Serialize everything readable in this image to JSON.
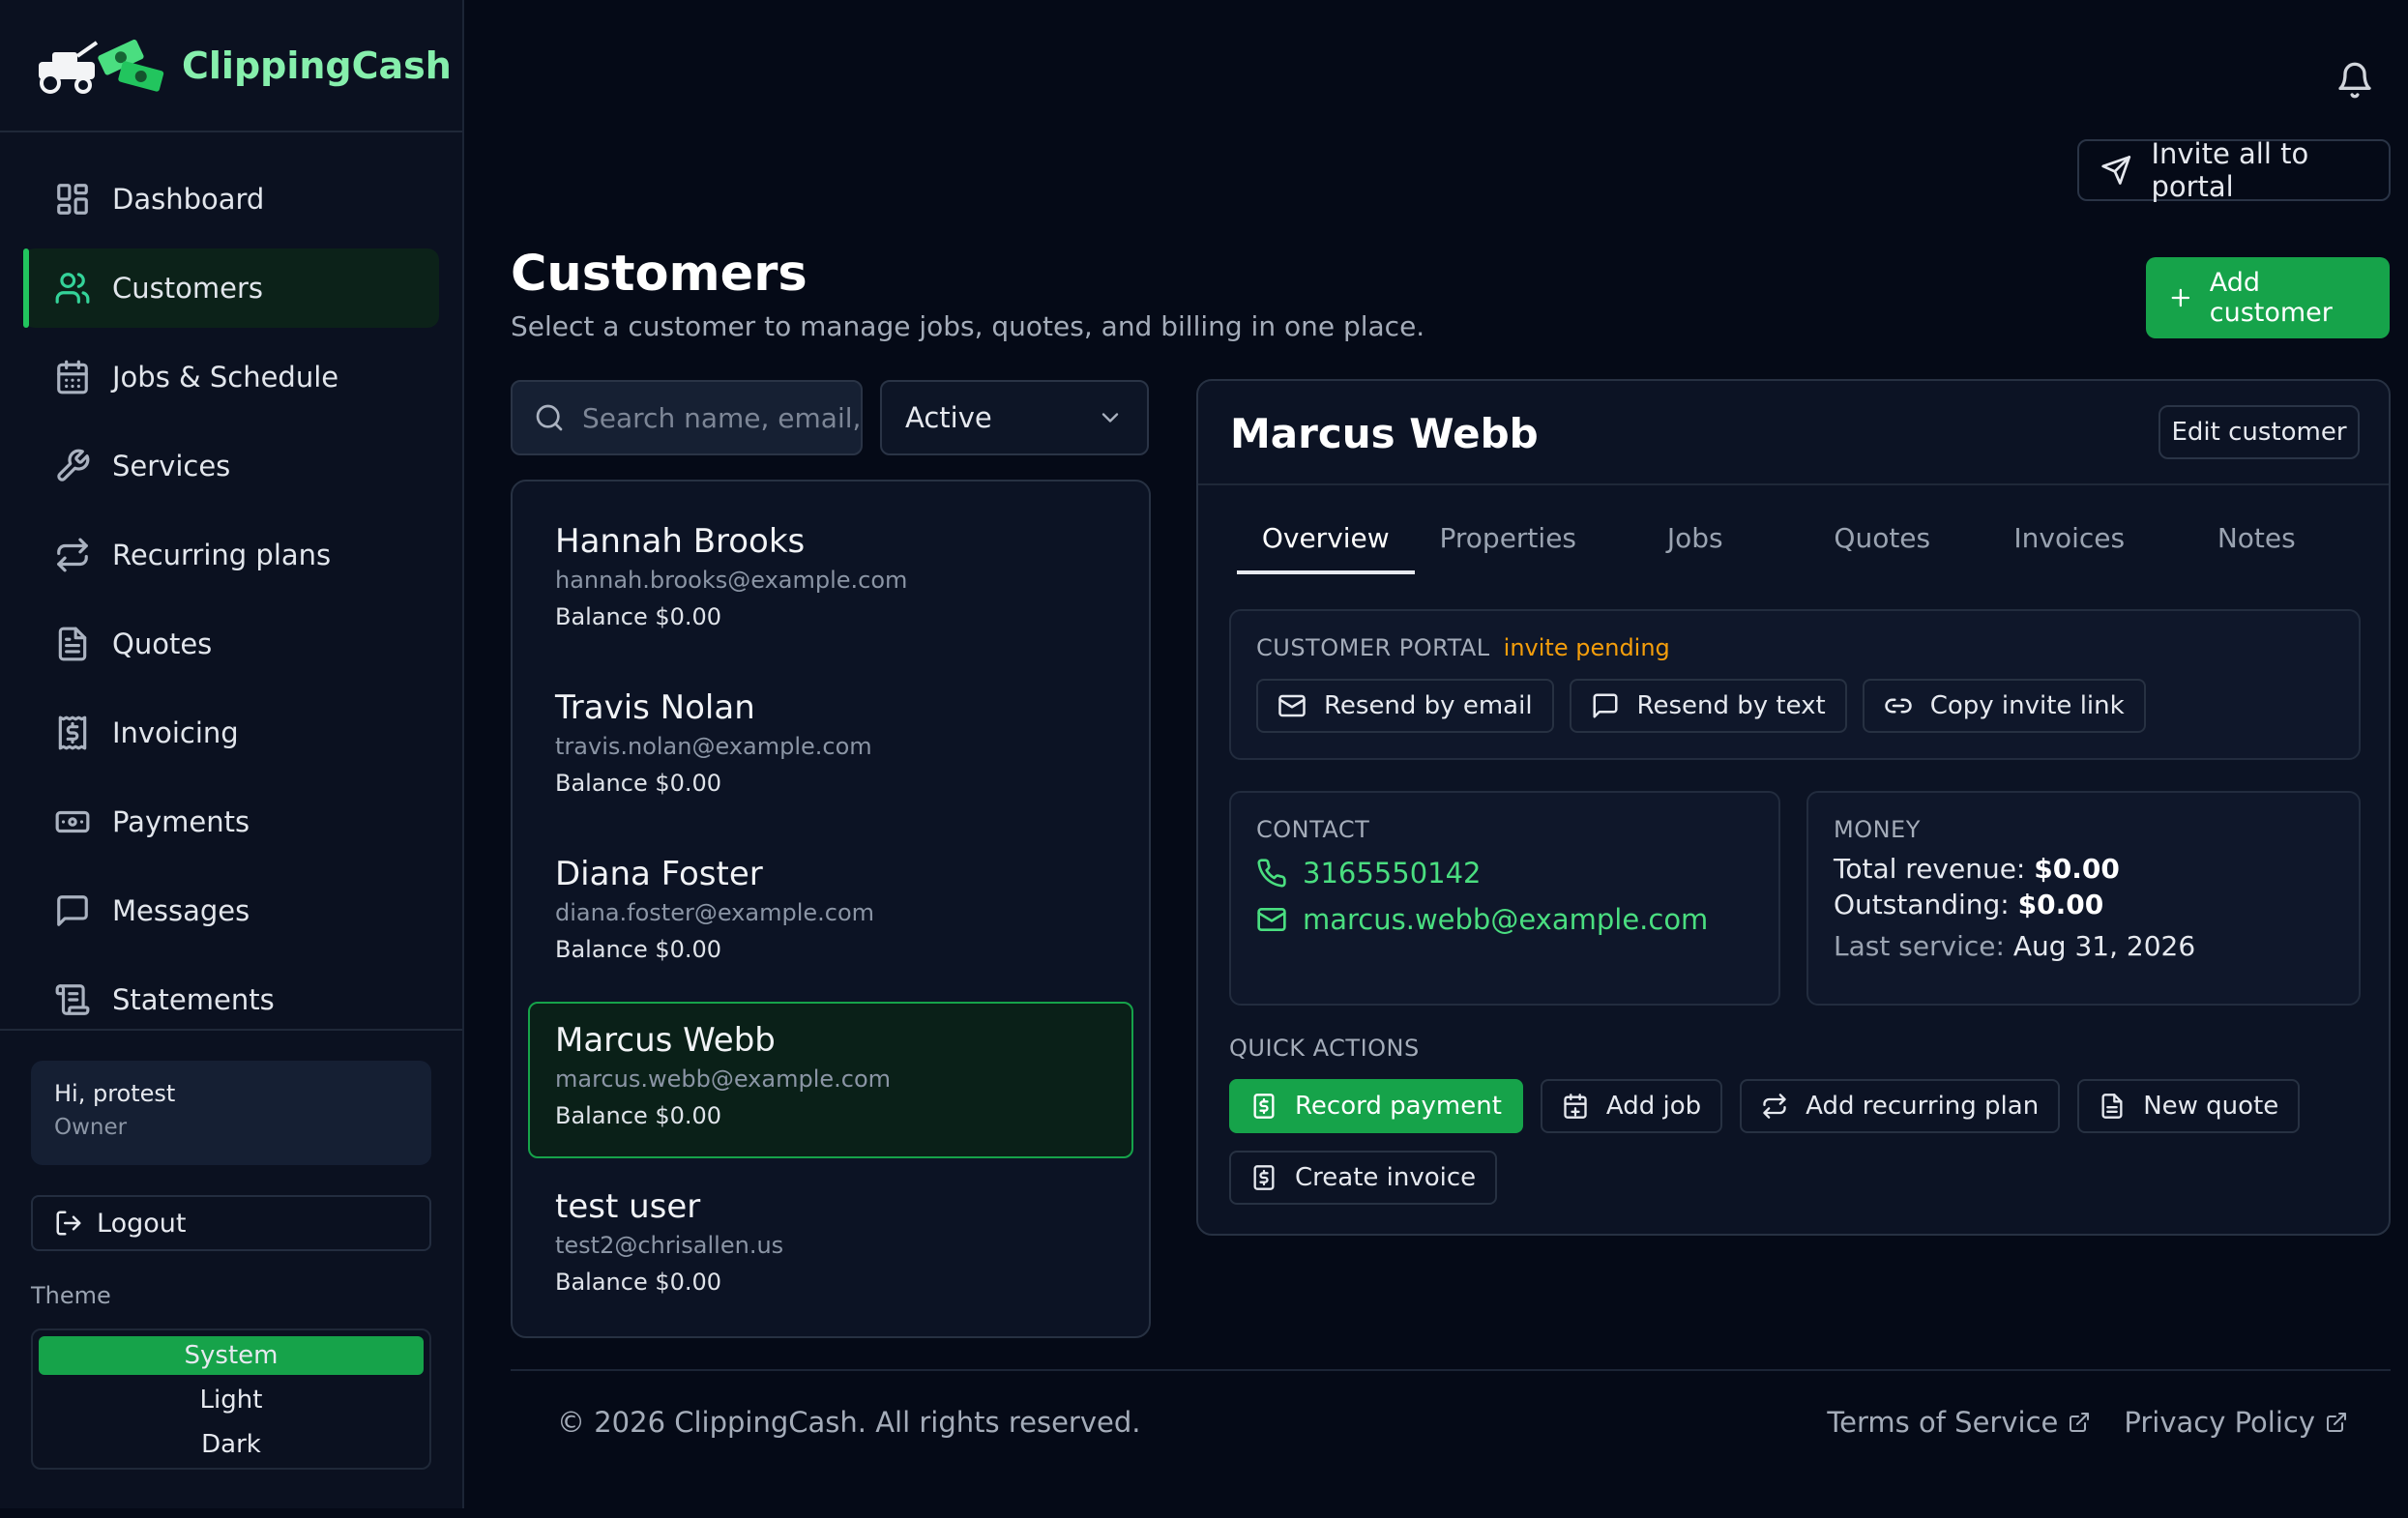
{
  "brand": {
    "name": "ClippingCash"
  },
  "sidebar": {
    "items": [
      {
        "label": "Dashboard",
        "icon": "dashboard-grid-icon"
      },
      {
        "label": "Customers",
        "icon": "users-icon",
        "active": true
      },
      {
        "label": "Jobs & Schedule",
        "icon": "calendar-icon"
      },
      {
        "label": "Services",
        "icon": "wrench-icon"
      },
      {
        "label": "Recurring plans",
        "icon": "repeat-icon"
      },
      {
        "label": "Quotes",
        "icon": "document-icon"
      },
      {
        "label": "Invoicing",
        "icon": "invoice-icon"
      },
      {
        "label": "Payments",
        "icon": "banknote-icon"
      },
      {
        "label": "Messages",
        "icon": "message-icon"
      },
      {
        "label": "Statements",
        "icon": "scroll-icon"
      }
    ],
    "user": {
      "greeting": "Hi, protest",
      "role": "Owner"
    },
    "logout_label": "Logout",
    "theme": {
      "label": "Theme",
      "options": [
        "System",
        "Light",
        "Dark"
      ],
      "selected": "System"
    }
  },
  "header": {
    "invite_all_label": "Invite all to portal",
    "add_customer_label": "Add customer",
    "title": "Customers",
    "subtitle": "Select a customer to manage jobs, quotes, and billing in one place."
  },
  "search": {
    "placeholder": "Search name, email, phone",
    "value": ""
  },
  "filter": {
    "selected": "Active"
  },
  "customers": [
    {
      "name": "Hannah Brooks",
      "email": "hannah.brooks@example.com",
      "balance": "Balance $0.00"
    },
    {
      "name": "Travis Nolan",
      "email": "travis.nolan@example.com",
      "balance": "Balance $0.00"
    },
    {
      "name": "Diana Foster",
      "email": "diana.foster@example.com",
      "balance": "Balance $0.00"
    },
    {
      "name": "Marcus Webb",
      "email": "marcus.webb@example.com",
      "balance": "Balance $0.00",
      "selected": true
    },
    {
      "name": "test user",
      "email": "test2@chrisallen.us",
      "balance": "Balance $0.00"
    }
  ],
  "detail": {
    "name": "Marcus Webb",
    "edit_label": "Edit customer",
    "tabs": [
      "Overview",
      "Properties",
      "Jobs",
      "Quotes",
      "Invoices",
      "Notes"
    ],
    "active_tab": "Overview",
    "portal": {
      "label": "CUSTOMER PORTAL",
      "status": "invite pending",
      "buttons": [
        "Resend by email",
        "Resend by text",
        "Copy invite link"
      ]
    },
    "contact": {
      "label": "CONTACT",
      "phone": "3165550142",
      "email": "marcus.webb@example.com"
    },
    "money": {
      "label": "MONEY",
      "total_revenue_label": "Total revenue:",
      "total_revenue": "$0.00",
      "outstanding_label": "Outstanding:",
      "outstanding": "$0.00",
      "last_service_label": "Last service:",
      "last_service": "Aug 31, 2026"
    },
    "quick_actions": {
      "label": "QUICK ACTIONS",
      "buttons": [
        "Record payment",
        "Add job",
        "Add recurring plan",
        "New quote",
        "Create invoice"
      ]
    }
  },
  "footer": {
    "copyright": "© 2026 ClippingCash. All rights reserved.",
    "terms": "Terms of Service",
    "privacy": "Privacy Policy"
  },
  "colors": {
    "accent": "#16a34a",
    "brand_text": "#86efac",
    "pending": "#f59e0b",
    "link": "#4ade80",
    "background": "#050a17"
  }
}
